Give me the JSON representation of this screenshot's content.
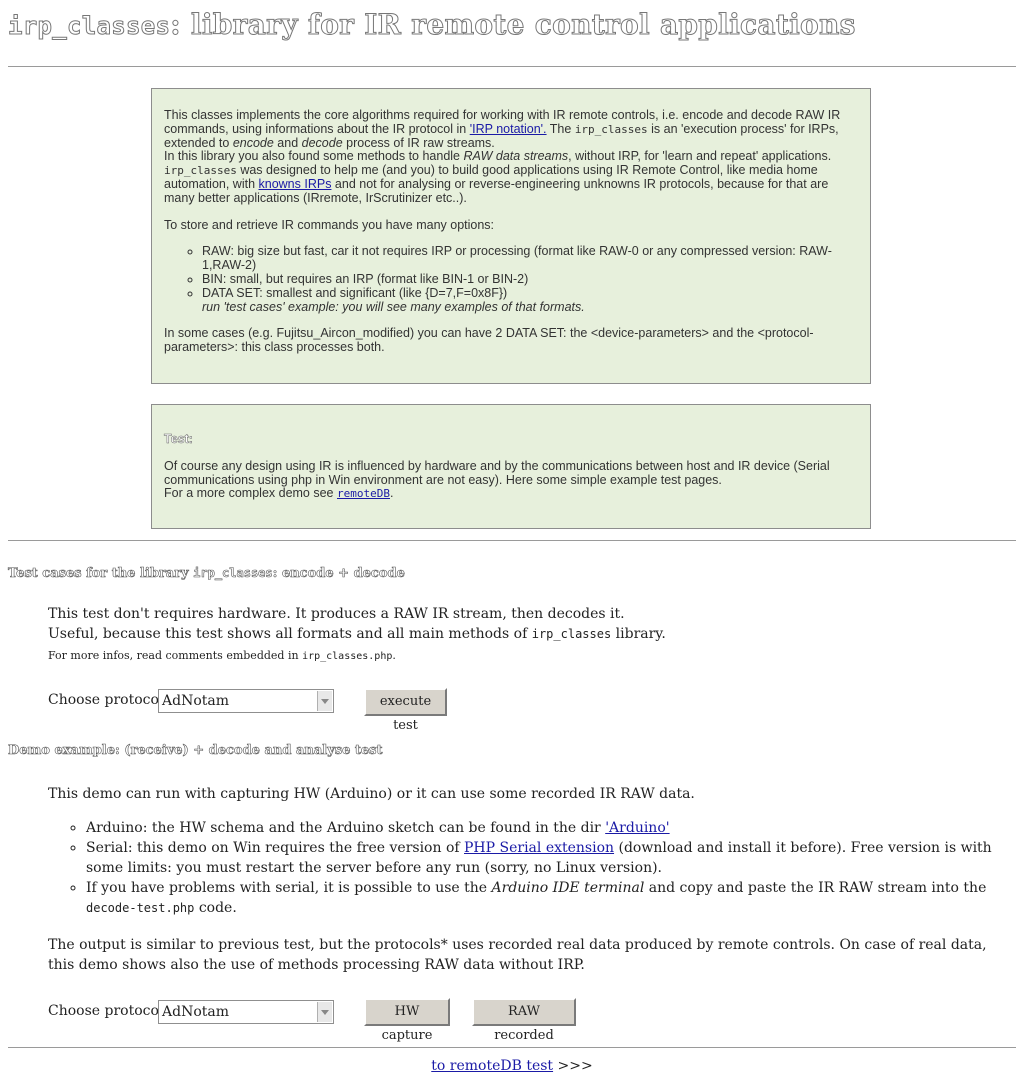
{
  "title": {
    "code": "irp_classes",
    "rest": ": library for IR remote control applications"
  },
  "intro": {
    "p1_a": "This classes implements the core algorithms required for working with IR remote controls, i.e. encode and decode RAW IR commands, using informations about the IR protocol in ",
    "irp_link": "'IRP notation'.",
    "p1_b": " The ",
    "p1_code": "irp_classes",
    "p1_c": " is an 'execution process' for IRPs, extended to ",
    "p1_enc": "encode",
    "p1_d": " and ",
    "p1_dec": "decode",
    "p1_e": " process of IR raw streams.",
    "p2_a": "In this library you also found some methods to handle ",
    "p2_em": "RAW data streams",
    "p2_b": ", without IRP, for 'learn and repeat' applications.",
    "p3_code": "irp_classes",
    "p3_a": " was designed to help me (and you) to build good applications using IR Remote Control, like media home automation, with ",
    "p3_link": "knowns IRPs",
    "p3_b": " and not for analysing or reverse-engineering unknowns IR protocols, because for that are many better applications (IRremote, IrScrutinizer etc..).",
    "p4": "To store and retrieve IR commands you have many options:",
    "opt_raw": "RAW: big size but fast, car it not requires IRP or processing (format like RAW-0 or any compressed version: RAW-1,RAW-2)",
    "opt_bin": "BIN: small, but requires an IRP (format like BIN-1 or BIN-2)",
    "opt_data": "DATA SET: smallest and significant (like {D=7,F=0x8F})",
    "opt_data_note": "run 'test cases' example: you will see many examples of that formats.",
    "p5": "In some cases (e.g. Fujitsu_Aircon_modified) you can have 2 DATA SET: the <device-parameters> and the <protocol-parameters>: this class processes both."
  },
  "tests_box": {
    "heading": "Test:",
    "p1": "Of course any design using IR is influenced by hardware and by the communications between host and IR device (Serial communications using php in Win environment are not easy). Here some simple example test pages.",
    "p2_a": "For a more complex demo see ",
    "p2_link": "remoteDB",
    "p2_b": "."
  },
  "test_cases": {
    "heading_a": "Test cases for the library ",
    "heading_code": "irp_classes",
    "heading_b": ": encode + decode",
    "line1": "This test don't requires hardware. It produces a RAW IR stream, then decodes it.",
    "line2_a": "Useful, because this test shows all formats and all main methods of ",
    "line2_code": "irp_classes",
    "line2_b": " library.",
    "line3_a": "For more infos, read comments embedded in ",
    "line3_code": "irp_classes.php",
    "line3_b": ".",
    "protocol_label": "Choose protocol:",
    "protocol_value": "AdNotam",
    "button": "execute test"
  },
  "demo": {
    "heading": "Demo example: (receive) + decode and analyse test",
    "intro": "This demo can run with capturing HW (Arduino) or it can use some recorded IR RAW data.",
    "item1_a": "Arduino: the HW schema and the Arduino sketch can be found in the dir ",
    "item1_link": "'Arduino'",
    "item2_a": "Serial: this demo on Win requires the free version of ",
    "item2_link": "PHP Serial extension",
    "item2_b": " (download and install it before). Free version is with some limits: you must restart the server before any run (sorry, no Linux version).",
    "item3_a": "If you have problems with serial, it is possible to use the ",
    "item3_em": "Arduino IDE terminal",
    "item3_b": " and copy and paste the IR RAW stream into the ",
    "item3_code": "decode-test.php",
    "item3_c": " code.",
    "outro": "The output is similar to previous test, but the protocols* uses recorded real data produced by remote controls. On case of real data, this demo shows also the use of methods processing RAW data without IRP.",
    "protocol_label": "Choose protocol:",
    "protocol_value": "AdNotam",
    "btn_hw": "HW capture",
    "btn_raw": "RAW recorded"
  },
  "footer": {
    "link": "to remoteDB test",
    "suffix": " >>>"
  }
}
